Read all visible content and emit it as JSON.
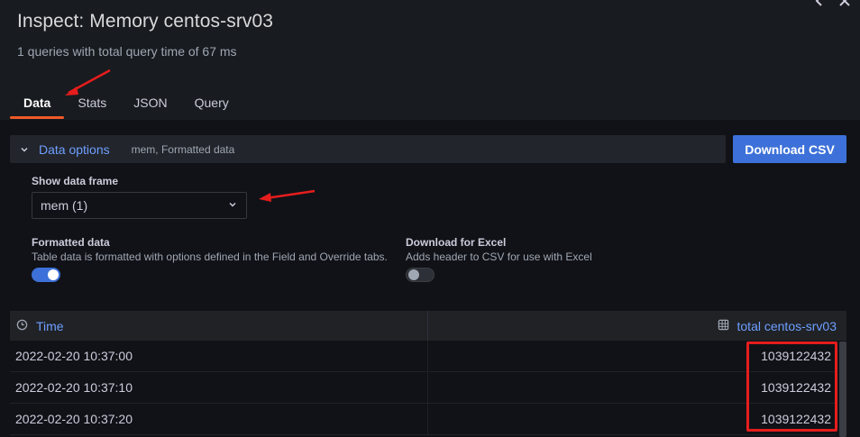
{
  "header": {
    "title": "Inspect: Memory centos-srv03",
    "subtitle": "1 queries with total query time of 67 ms"
  },
  "tabs": [
    {
      "label": "Data",
      "active": true
    },
    {
      "label": "Stats",
      "active": false
    },
    {
      "label": "JSON",
      "active": false
    },
    {
      "label": "Query",
      "active": false
    }
  ],
  "data_options": {
    "label": "Data options",
    "summary": "mem, Formatted data",
    "download_csv": "Download CSV",
    "show_frame_label": "Show data frame",
    "frame_value": "mem (1)",
    "formatted": {
      "label": "Formatted data",
      "desc": "Table data is formatted with options defined in the Field and Override tabs.",
      "enabled": true
    },
    "excel": {
      "label": "Download for Excel",
      "desc": "Adds header to CSV for use with Excel",
      "enabled": false
    }
  },
  "table": {
    "columns": [
      "Time",
      "total centos-srv03"
    ],
    "rows": [
      [
        "2022-02-20 10:37:00",
        "1039122432"
      ],
      [
        "2022-02-20 10:37:10",
        "1039122432"
      ],
      [
        "2022-02-20 10:37:20",
        "1039122432"
      ]
    ]
  },
  "colors": {
    "accent": "#3d71d9",
    "link": "#6e9fff",
    "active_tab_underline": "#f05a28",
    "annotation_red": "#e51d1d"
  }
}
